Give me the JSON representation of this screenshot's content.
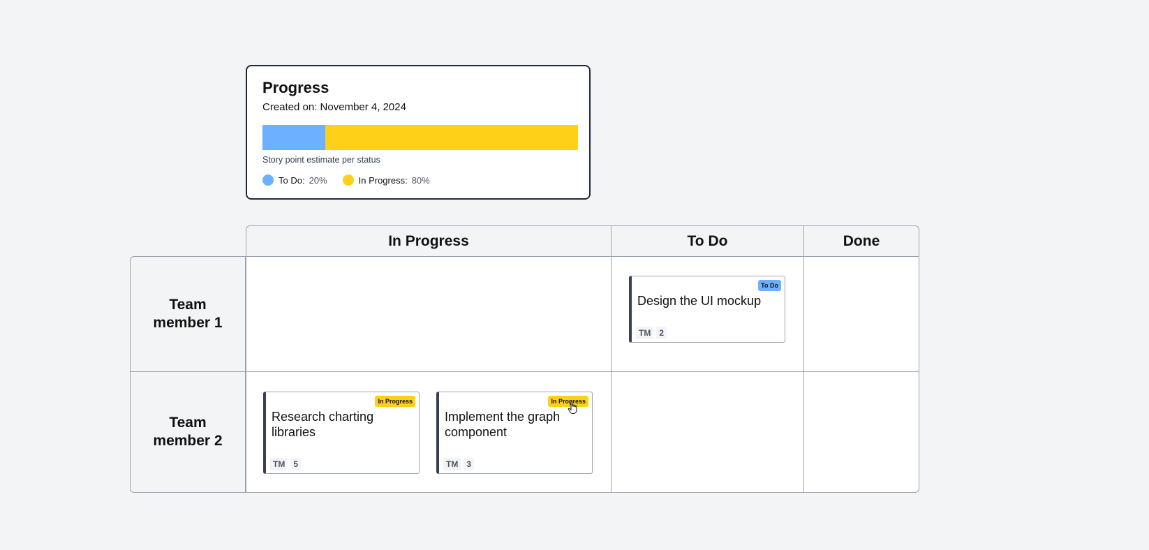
{
  "progress": {
    "title": "Progress",
    "created": "Created on: November 4, 2024",
    "caption": "Story point estimate per status",
    "segments": [
      {
        "label": "To Do:",
        "percent": "20%",
        "fraction": 0.2,
        "color": "#6cb0ff"
      },
      {
        "label": "In Progress:",
        "percent": "80%",
        "fraction": 0.8,
        "color": "#fed017"
      }
    ]
  },
  "board": {
    "columns": [
      "In Progress",
      "To Do",
      "Done"
    ],
    "rows": [
      "Team member 1",
      "Team member 2"
    ],
    "cards": [
      {
        "title": "Design the UI mockup",
        "status": "To Do",
        "status_color": "#6cb0ff",
        "assignee": "TM",
        "points": "2"
      },
      {
        "title": "Research charting libraries",
        "status": "In Progress",
        "status_color": "#fed017",
        "assignee": "TM",
        "points": "5"
      },
      {
        "title": "Implement the graph component",
        "status": "In Progress",
        "status_color": "#fed017",
        "assignee": "TM",
        "points": "3"
      }
    ]
  }
}
